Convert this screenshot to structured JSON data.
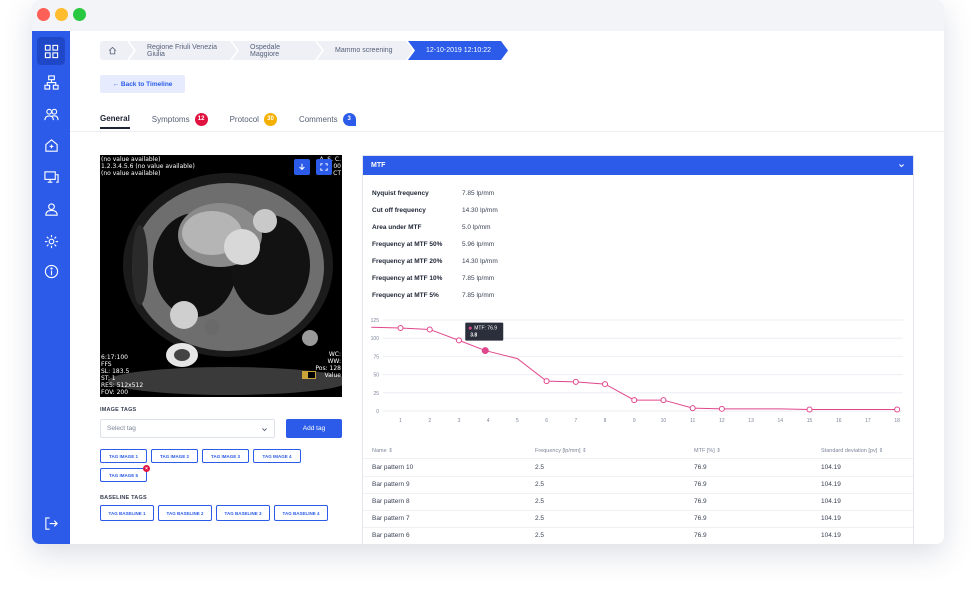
{
  "colors": {
    "primary": "#2b5be8",
    "symptoms_badge": "#e0123f",
    "protocol_badge": "#f4b000",
    "comments_badge": "#2b5be8",
    "chart_line": "#e0468c"
  },
  "sidebar": {
    "icons": [
      "dashboard-icon",
      "hierarchy-icon",
      "users-icon",
      "hospital-icon",
      "device-icon",
      "user-group-icon",
      "settings-icon",
      "info-icon",
      "logout-icon"
    ]
  },
  "breadcrumb": {
    "items": [
      "Regione Friuli Venezia Giulia",
      "Ospedale Maggiore",
      "Mammo screening",
      "12-10-2019 12:10:22"
    ]
  },
  "back_button": "← Back to Timeline",
  "tabs": [
    {
      "label": "General",
      "badge": ""
    },
    {
      "label": "Symptoms",
      "badge": "12"
    },
    {
      "label": "Protocol",
      "badge": "30"
    },
    {
      "label": "Comments",
      "badge": "3"
    }
  ],
  "scan": {
    "top_left": "(no value available)\n1.2.3.4.5.6 (no value available)\n(no value available)",
    "top_right": "A. S. C.\n00\nCT",
    "bottom_left": "6:17:100\nFFS\nSL: 183.5\nST: 1\nRES: 512x512\nFOV: 200",
    "bottom_right": "WC:\nWW:\nPos: 128\nValue"
  },
  "image_tags": {
    "label": "IMAGE TAGS",
    "placeholder": "Select tag",
    "add_button": "Add tag",
    "tags": [
      "TAG IMAGE 1",
      "TAG IMAGE 2",
      "TAG IMAGE 3",
      "TAG IMAGE 4",
      "TAG IMAGE 5"
    ]
  },
  "baseline_tags": {
    "label": "BASELINE TAGS",
    "tags": [
      "TAG BASELINE 1",
      "TAG BASELINE 2",
      "TAG BASELINE 3",
      "TAG BASELINE 4"
    ]
  },
  "mtf": {
    "title": "MTF",
    "metrics": [
      {
        "label": "Nyquist frequency",
        "value": "7.85 lp/mm"
      },
      {
        "label": "Cut off frequency",
        "value": "14.30 lp/mm"
      },
      {
        "label": "Area under MTF",
        "value": "5.0 lp/mm"
      },
      {
        "label": "Frequency at MTF 50%",
        "value": "5.96 lp/mm"
      },
      {
        "label": "Frequency at MTF 20%",
        "value": "14.30 lp/mm"
      },
      {
        "label": "Frequency at MTF 10%",
        "value": "7.85 lp/mm"
      },
      {
        "label": "Frequency at MTF 5%",
        "value": "7.85 lp/mm"
      }
    ],
    "tooltip": {
      "line1": "MTF: 76.9",
      "line2": "3.8"
    },
    "table": {
      "headers": [
        "Name ⇕",
        "Frequency [lp/mm] ⇕",
        "MTF [%] ⇕",
        "Standard deviation [pv] ⇕"
      ],
      "rows": [
        [
          "Bar pattern 10",
          "2.5",
          "76.9",
          "104.19"
        ],
        [
          "Bar pattern 9",
          "2.5",
          "76.9",
          "104.19"
        ],
        [
          "Bar pattern 8",
          "2.5",
          "76.9",
          "104.19"
        ],
        [
          "Bar pattern 7",
          "2.5",
          "76.9",
          "104.19"
        ],
        [
          "Bar pattern 6",
          "2.5",
          "76.9",
          "104.19"
        ]
      ]
    }
  },
  "chart_data": {
    "type": "line",
    "x": [
      0,
      1,
      2,
      3,
      3.9,
      5,
      6,
      7,
      8,
      9,
      10,
      11,
      12,
      13,
      14,
      15,
      16,
      17,
      18
    ],
    "values": [
      115,
      114,
      112,
      97,
      83,
      72,
      41,
      40,
      37,
      15,
      15,
      4,
      3,
      3,
      3,
      2,
      2,
      2,
      2
    ],
    "xticks": [
      1,
      2,
      3,
      4,
      5,
      6,
      7,
      8,
      9,
      10,
      11,
      12,
      13,
      14,
      15,
      16,
      17,
      18
    ],
    "yticks": [
      0,
      25,
      50,
      75,
      100,
      125
    ],
    "markers_at": [
      1,
      2,
      3,
      4,
      6,
      7,
      8,
      9,
      10,
      11,
      12,
      15,
      18
    ],
    "xlim": [
      0.4,
      18.2
    ],
    "ylim": [
      0,
      125
    ],
    "grid": true
  }
}
